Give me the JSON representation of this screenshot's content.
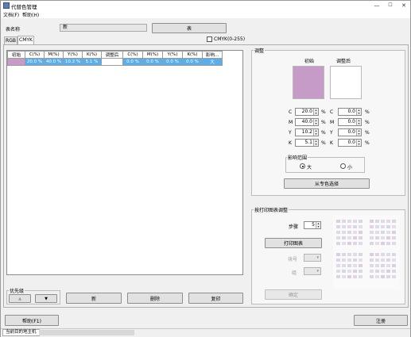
{
  "window": {
    "title": "代替色管理",
    "min": "—",
    "max": "☐",
    "close": "✕"
  },
  "menu": [
    "文档(F)",
    "帮助(H)"
  ],
  "table_name": {
    "label": "表名称",
    "value": "新",
    "button": "表"
  },
  "tabs": [
    "RGB",
    "CMYK"
  ],
  "cmyk_range_label": "CMYK(0-255)",
  "grid": {
    "headers": [
      "初始",
      "C(%)",
      "M(%)",
      "Y(%)",
      "K(%)",
      "调整后",
      "C(%)",
      "M(%)",
      "Y(%)",
      "K(%)",
      "影响..."
    ],
    "rows": [
      {
        "cells": [
          "",
          "20.0 %",
          "40.0 %",
          "10.2 %",
          "5.1 %",
          "",
          "0.0 %",
          "0.0 %",
          "0.0 %",
          "0.0 %",
          "大"
        ]
      }
    ],
    "initial_color": "#c69bc7"
  },
  "priority": {
    "label": "优先级",
    "up": "▲",
    "down": "▼"
  },
  "actions": {
    "new": "新",
    "delete": "删除",
    "copy": "复印"
  },
  "adjust": {
    "title": "调整",
    "initial_label": "初始",
    "after_label": "调整后",
    "initial_color": "#c69bc7",
    "after_color": "#ffffff",
    "left": [
      {
        "ch": "C",
        "value": "20.0"
      },
      {
        "ch": "M",
        "value": "40.0"
      },
      {
        "ch": "Y",
        "value": "10.2"
      },
      {
        "ch": "K",
        "value": "5.1"
      }
    ],
    "right": [
      {
        "ch": "C",
        "value": "0.0"
      },
      {
        "ch": "M",
        "value": "0.0"
      },
      {
        "ch": "Y",
        "value": "0.0"
      },
      {
        "ch": "K",
        "value": "0.0"
      }
    ],
    "unit": "%",
    "influence": {
      "title": "影响范围",
      "large": "大",
      "small": "小"
    },
    "spot_button": "从专色选择"
  },
  "print_adjust": {
    "title": "按打印图表调整",
    "step_label": "步骤",
    "step_value": "5",
    "print_button": "打印图表",
    "chart_no_label": "块号",
    "group_label": "组",
    "confirm_button": "确定"
  },
  "help_button": "帮助(F1)",
  "register_button": "注册",
  "status": "当前目的地主机"
}
